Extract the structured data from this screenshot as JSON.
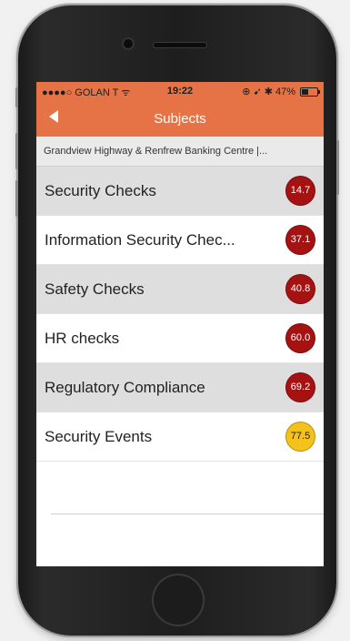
{
  "status_bar": {
    "carrier": "●●●●○ GOLAN T",
    "wifi": "ᯤ",
    "time": "19:22",
    "status_icons": "⊕ ➹ ✱",
    "battery": "47%"
  },
  "nav": {
    "back_icon": "chevron-left",
    "title": "Subjects"
  },
  "location": "Grandview Highway & Renfrew Banking Centre |...",
  "colors": {
    "brand": "#e57346",
    "red": "#a51212",
    "yellow": "#f5c11b"
  },
  "subjects": [
    {
      "label": "Security  Checks",
      "score": "14.7",
      "color": "#a51212",
      "text": "#ffffff"
    },
    {
      "label": "Information Security Chec...",
      "score": "37.1",
      "color": "#a51212",
      "text": "#ffffff"
    },
    {
      "label": "Safety Checks",
      "score": "40.8",
      "color": "#a51212",
      "text": "#ffffff"
    },
    {
      "label": "HR checks",
      "score": "60.0",
      "color": "#a51212",
      "text": "#ffffff"
    },
    {
      "label": "Regulatory Compliance",
      "score": "69.2",
      "color": "#a51212",
      "text": "#ffffff"
    },
    {
      "label": "Security Events",
      "score": "77.5",
      "color": "#f5c11b",
      "text": "#222222"
    }
  ]
}
